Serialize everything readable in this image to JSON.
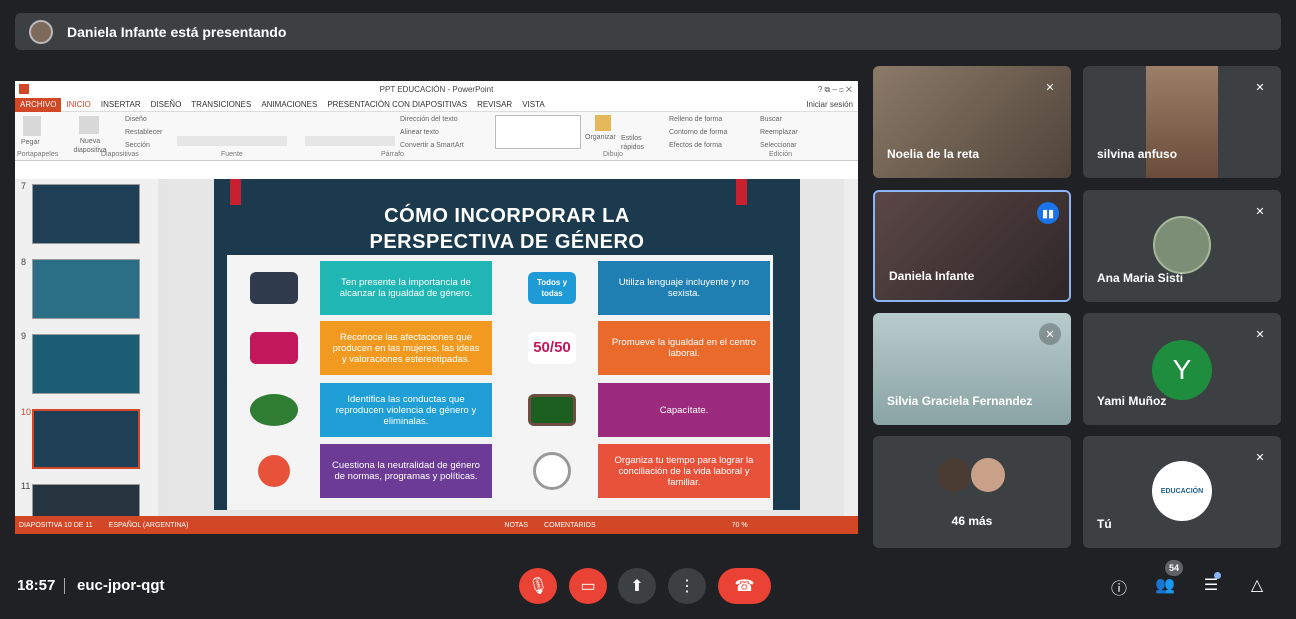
{
  "presenter_bar": {
    "text": "Daniela Infante está presentando"
  },
  "powerpoint": {
    "window_title": "PPT EDUCACIÓN - PowerPoint",
    "window_controls": "? ⧉ – ◻ ✕",
    "tabs": [
      "ARCHIVO",
      "INICIO",
      "INSERTAR",
      "DISEÑO",
      "TRANSICIONES",
      "ANIMACIONES",
      "PRESENTACIÓN CON DIAPOSITIVAS",
      "REVISAR",
      "VISTA"
    ],
    "sign_in": "Iniciar sesión",
    "ribbon": {
      "paste": "Pegar",
      "new_slide": "Nueva diapositiva",
      "layout": "Diseño",
      "reset": "Restablecer",
      "section": "Sección",
      "text_direction": "Dirección del texto",
      "align_text": "Alinear texto",
      "convert_smartart": "Convertir a SmartArt",
      "arrange": "Organizar",
      "quick_styles": "Estilos rápidos",
      "shape_fill": "Relleno de forma",
      "shape_outline": "Contorno de forma",
      "shape_effects": "Efectos de forma",
      "find": "Buscar",
      "replace": "Reemplazar",
      "select": "Seleccionar",
      "groups": [
        "Portapapeles",
        "Diapositivas",
        "Fuente",
        "Párrafo",
        "Dibujo",
        "Edición"
      ]
    },
    "thumb_numbers": [
      "7",
      "8",
      "9",
      "10",
      "11"
    ],
    "slide": {
      "title": "CÓMO INCORPORAR LA PERSPECTIVA DE GÉNERO",
      "cards": [
        {
          "text": "Ten presente la importancia de alcanzar la igualdad de género.",
          "color": "#1fb6b3"
        },
        {
          "text": "Utiliza lenguaje incluyente y no sexista.",
          "color": "#1f7fb3"
        },
        {
          "text": "Reconoce las afectaciones que producen en las mujeres, las ideas y valoraciones estereotipadas.",
          "color": "#f29a1f"
        },
        {
          "text": "Promueve la igualdad en el centro laboral.",
          "color": "#ea6a2c"
        },
        {
          "text": "Identifica las conductas que reproducen violencia de género y eliminalas.",
          "color": "#1f9fd6"
        },
        {
          "text": "Capacítate.",
          "color": "#9c2a7d"
        },
        {
          "text": "Cuestiona la neutralidad de género de normas, programas y políticas.",
          "color": "#6c3b95"
        },
        {
          "text": "Organiza tu tiempo para lograr la conciliación de la vida laboral y familiar.",
          "color": "#e8523b"
        }
      ],
      "badges": {
        "todos": "Todos y todas",
        "fifty": "50/50"
      }
    },
    "status": {
      "slide": "DIAPOSITIVA 10 DE 11",
      "lang": "ESPAÑOL (ARGENTINA)",
      "notes": "NOTAS",
      "comments": "COMENTARIOS",
      "zoom": "70 %"
    }
  },
  "participants": [
    {
      "name": "Noelia de la reta",
      "bg": "#6e5f52",
      "muted": true
    },
    {
      "name": "silvina anfuso",
      "bg": "#8a6e5a",
      "muted": true
    },
    {
      "name": "Daniela Infante",
      "bg": "#4d3b3b",
      "muted": false,
      "speaking": true
    },
    {
      "name": "Ana Maria Sisti",
      "bg": "#3c4043",
      "muted": true
    },
    {
      "name": "Silvia Graciela Fernandez",
      "bg": "#9bb3b4",
      "muted": true
    },
    {
      "name": "Yami Muñoz",
      "bg": "#3c4043",
      "muted": true,
      "initial": "Y",
      "initial_bg": "#1e8e3e"
    },
    {
      "name": "46 más",
      "bg": "#3c4043",
      "muted": false
    },
    {
      "name": "Tú",
      "bg": "#3c4043",
      "muted": true,
      "logo_text": "EDUCACIÓN"
    }
  ],
  "bottom": {
    "time": "18:57",
    "meeting_code": "euc-jpor-qgt",
    "people_count": "54",
    "colors": {
      "danger": "#ea4335",
      "button": "#3c4043"
    }
  }
}
